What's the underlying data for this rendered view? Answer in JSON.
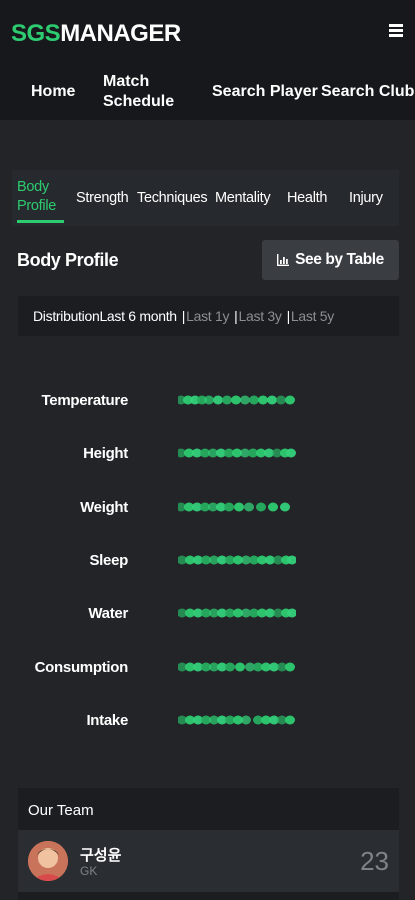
{
  "brand": {
    "part1": "SGS",
    "part2": "MANAGER"
  },
  "nav": {
    "home": "Home",
    "match_line1": "Match",
    "match_line2": "Schedule",
    "search_player": "Search Player",
    "search_club": "Search Club"
  },
  "tabs": {
    "body_line1": "Body",
    "body_line2": "Profile",
    "strength": "Strength",
    "techniques": "Techniques",
    "mentality": "Mentality",
    "health": "Health",
    "injury": "Injury"
  },
  "section": {
    "title": "Body Profile",
    "table_button": "See by Table"
  },
  "period": {
    "label": "Distribution",
    "options": [
      "Last 6 month",
      "Last 1y",
      "Last 3y",
      "Last 5y"
    ],
    "separator": "|",
    "selected": "Last 6 month"
  },
  "metrics": [
    {
      "label": "Temperature"
    },
    {
      "label": "Height"
    },
    {
      "label": "Weight"
    },
    {
      "label": "Sleep"
    },
    {
      "label": "Water"
    },
    {
      "label": "Consumption"
    },
    {
      "label": "Intake"
    }
  ],
  "team": {
    "title": "Our Team",
    "player": {
      "name": "구성윤",
      "position": "GK",
      "number": "23"
    }
  },
  "colors": {
    "accent": "#2ecc71",
    "background": "#222428",
    "header": "#16181b"
  }
}
